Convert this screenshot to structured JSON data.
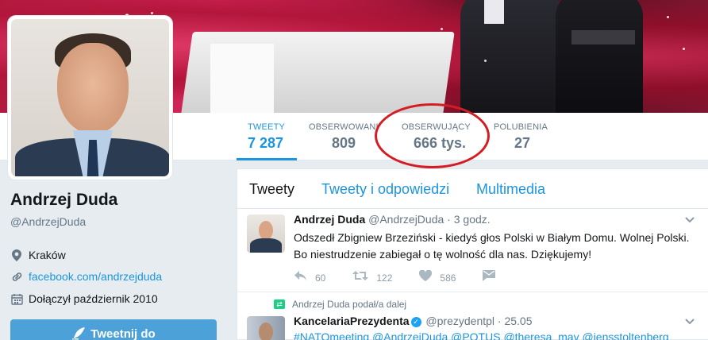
{
  "profile": {
    "name": "Andrzej Duda",
    "handle": "@AndrzejDuda",
    "location": "Kraków",
    "website": "facebook.com/andrzejduda",
    "joined": "Dołączył październik 2010",
    "tweet_button": "Tweetnij do"
  },
  "nav": {
    "stats": [
      {
        "label": "TWEETY",
        "value": "7 287",
        "active": true
      },
      {
        "label": "OBSERWOWANI",
        "value": "809"
      },
      {
        "label": "OBSERWUJĄCY",
        "value": "666 tys."
      },
      {
        "label": "POLUBIENIA",
        "value": "27"
      }
    ]
  },
  "timeline": {
    "tabs": [
      "Tweety",
      "Tweety i odpowiedzi",
      "Multimedia"
    ],
    "tweets": [
      {
        "name": "Andrzej Duda",
        "handle": "@AndrzejDuda",
        "separator": "·",
        "time": "3 godz.",
        "text": "Odszedł Zbigniew Brzeziński - kiedyś głos Polski w Białym Domu. Wolnej Polski. Bo niestrudzenie zabiegał o tę wolność dla nas. Dziękujemy!",
        "replies": "60",
        "retweets": "122",
        "likes": "586"
      },
      {
        "retweet_context": "Andrzej Duda podał/a dalej",
        "name": "KancelariaPrezydenta",
        "handle": "@prezydentpl",
        "separator": "·",
        "time": "25.05",
        "text": "#NATOmeeting @AndrzejDuda @POTUS @theresa_may @jensstoltenberg"
      }
    ]
  },
  "icons": {
    "location": "map-pin-icon",
    "link": "link-icon",
    "calendar": "calendar-icon",
    "reply": "reply-icon",
    "retweet": "retweet-icon",
    "like": "heart-icon",
    "dm": "direct-message-icon",
    "caret": "chevron-down-icon",
    "verified": "verified-badge-icon",
    "feather": "quill-icon"
  },
  "colors": {
    "accent": "#1b95e0",
    "annotation": "#d41d22",
    "tweet_button": "#4ba1d8",
    "retweet_green": "#19cf86"
  }
}
